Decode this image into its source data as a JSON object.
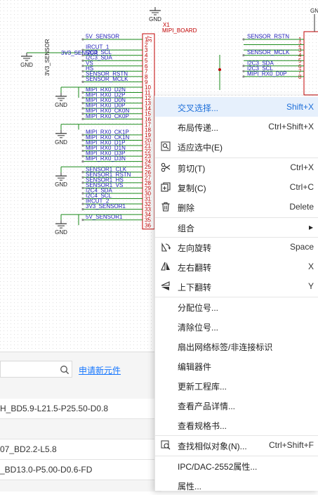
{
  "schematic": {
    "chip_designator": "X1",
    "chip_label": "MIPI_BOARD",
    "gnd_label": "GND",
    "left_pin_nets": [
      "5V_SENSOR",
      "",
      "IRCUT_1",
      "I2C3_SCL",
      "I2C3_SDA",
      "VS",
      "HS",
      "SENSOR_RSTN",
      "SENSOR_MCLK",
      "",
      "MIPI_RX0_D2N",
      "MIPI_RX0_D2P",
      "MIPI_RX0_D0N",
      "MIPI_RX0_D0P",
      "MIPI_RX0_CK0N",
      "MIPI_RX0_CK0P",
      "",
      "",
      "MIPI_RX0_CK1P",
      "MIPI_RX0_CK1N",
      "MIPI_RX0_D1P",
      "MIPI_RX0_D1N",
      "MIPI_RX0_D3P",
      "MIPI_RX0_D3N",
      "",
      "SENSOR1_CLK",
      "SENSOR1_RSTN",
      "SENSOR1_HS",
      "SENSOR1_VS",
      "I2C4_SDA",
      "I2C4_SCL",
      "IRCUT_2",
      "3V3_SENSOR1",
      "",
      "5V_SENSOR1",
      ""
    ],
    "left_pin_numbers": [
      "1",
      "2",
      "3",
      "4",
      "5",
      "6",
      "7",
      "8",
      "9",
      "10",
      "11",
      "12",
      "13",
      "14",
      "15",
      "16",
      "17",
      "18",
      "19",
      "20",
      "21",
      "22",
      "23",
      "24",
      "25",
      "26",
      "27",
      "28",
      "29",
      "30",
      "31",
      "32",
      "33",
      "34",
      "35",
      "36"
    ],
    "net_3v3": "3V3_SENSOR",
    "net_3v3_vertical": "3V3_SENSOR",
    "pin_37": "37",
    "right_pin_nets": [
      "SENSOR_RSTN",
      "",
      "",
      "SENSOR_MCLK",
      "",
      "I2C3_SDA",
      "I2C3_SCL",
      "MIPI_RX0_D0P"
    ],
    "right_pin_numbers": [
      "1",
      "2",
      "3",
      "4",
      "5",
      "6",
      "7",
      "8"
    ]
  },
  "bottom_panel": {
    "search_placeholder": "",
    "apply_link": "申请新元件",
    "rows": [
      "H_BD5.9-L21.5-P25.50-D0.8",
      "",
      "07_BD2.2-L5.8",
      "_BD13.0-P5.00-D0.6-FD"
    ]
  },
  "context_menu": {
    "items": [
      {
        "label": "交叉选择...",
        "shortcut": "Shift+X",
        "icon": "",
        "highlight": true
      },
      {
        "label": "布局传递...",
        "shortcut": "Ctrl+Shift+X",
        "icon": ""
      },
      {
        "label": "适应选中(E)",
        "shortcut": "",
        "icon": "fit-selection-icon"
      },
      {
        "label": "剪切(T)",
        "shortcut": "Ctrl+X",
        "icon": "scissors-icon"
      },
      {
        "label": "复制(C)",
        "shortcut": "Ctrl+C",
        "icon": "copy-icon"
      },
      {
        "label": "删除",
        "shortcut": "Delete",
        "icon": "trash-icon"
      },
      {
        "label": "组合",
        "shortcut": "",
        "icon": "",
        "submenu": true
      },
      {
        "label": "左向旋转",
        "shortcut": "Space",
        "icon": "rotate-left-icon"
      },
      {
        "label": "左右翻转",
        "shortcut": "X",
        "icon": "flip-horizontal-icon"
      },
      {
        "label": "上下翻转",
        "shortcut": "Y",
        "icon": "flip-vertical-icon"
      },
      {
        "label": "分配位号...",
        "shortcut": "",
        "icon": ""
      },
      {
        "label": "清除位号...",
        "shortcut": "",
        "icon": ""
      },
      {
        "label": "扇出网络标签/非连接标识",
        "shortcut": "",
        "icon": ""
      },
      {
        "label": "编辑器件",
        "shortcut": "",
        "icon": ""
      },
      {
        "label": "更新工程库...",
        "shortcut": "",
        "icon": ""
      },
      {
        "label": "查看产品详情...",
        "shortcut": "",
        "icon": ""
      },
      {
        "label": "查看规格书...",
        "shortcut": "",
        "icon": ""
      },
      {
        "label": "查找相似对象(N)...",
        "shortcut": "Ctrl+Shift+F",
        "icon": "find-similar-icon"
      },
      {
        "label": "IPC/DAC-2552属性...",
        "shortcut": "",
        "icon": ""
      },
      {
        "label": "属性...",
        "shortcut": "",
        "icon": ""
      }
    ],
    "submenu_arrow": "▸"
  },
  "colors": {
    "wire": "#1a8a1a",
    "net_label": "#1c1cb8",
    "pin_number": "#c00000",
    "chip_outline": "#c00000",
    "highlight_bg": "#e6f0fc",
    "highlight_text": "#1e6fd9",
    "link": "#1677ff"
  }
}
